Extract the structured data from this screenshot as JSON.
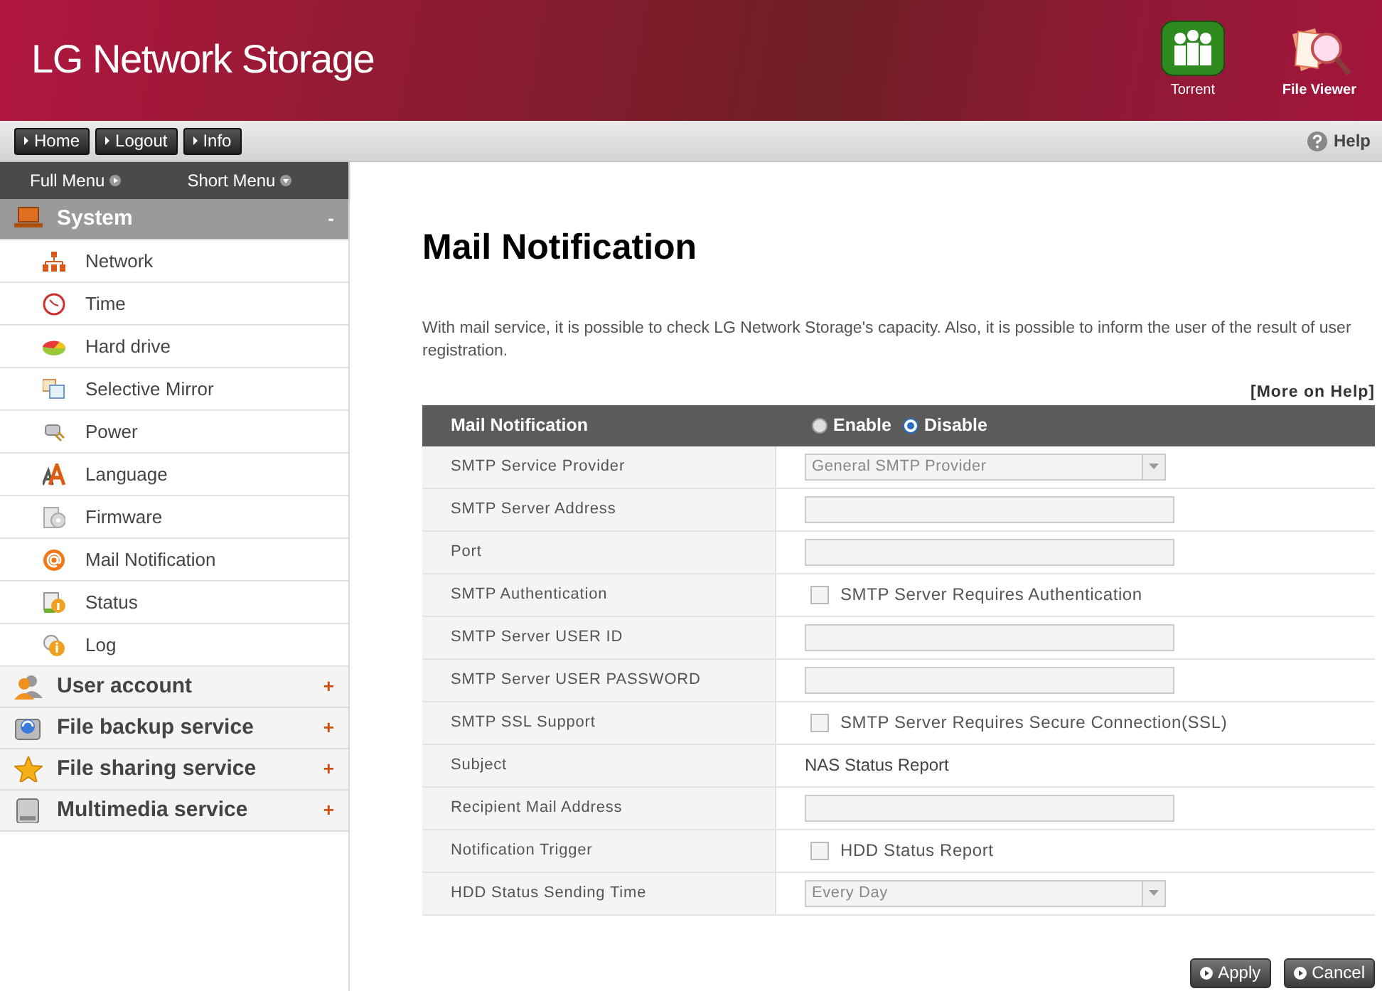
{
  "header": {
    "title": "LG Network Storage",
    "apps": [
      {
        "label": "Torrent"
      },
      {
        "label": "File Viewer"
      }
    ]
  },
  "toolbar": {
    "buttons": [
      "Home",
      "Logout",
      "Info"
    ],
    "help": "Help"
  },
  "sidebar": {
    "menus": [
      "Full Menu",
      "Short Menu"
    ],
    "sections": [
      {
        "label": "System",
        "expanded": true,
        "toggle": "-",
        "items": [
          "Network",
          "Time",
          "Hard drive",
          "Selective Mirror",
          "Power",
          "Language",
          "Firmware",
          "Mail Notification",
          "Status",
          "Log"
        ]
      },
      {
        "label": "User account",
        "expanded": false,
        "toggle": "+"
      },
      {
        "label": "File backup service",
        "expanded": false,
        "toggle": "+"
      },
      {
        "label": "File sharing service",
        "expanded": false,
        "toggle": "+"
      },
      {
        "label": "Multimedia service",
        "expanded": false,
        "toggle": "+"
      }
    ]
  },
  "main": {
    "title": "Mail Notification",
    "description": "With mail service, it is possible to check LG Network Storage's capacity. Also, it is possible to inform the user of the result of user registration.",
    "help_link": "[More on Help]",
    "form": {
      "header": "Mail Notification",
      "options": [
        {
          "label": "Enable",
          "selected": false
        },
        {
          "label": "Disable",
          "selected": true
        }
      ],
      "rows": [
        {
          "label": "SMTP Service Provider",
          "kind": "select",
          "value": "General SMTP Provider"
        },
        {
          "label": "SMTP Server Address",
          "kind": "text"
        },
        {
          "label": "Port",
          "kind": "text"
        },
        {
          "label": "SMTP Authentication",
          "kind": "checkbox",
          "checked": false,
          "text": "SMTP Server Requires Authentication"
        },
        {
          "label": "SMTP Server USER ID",
          "kind": "text"
        },
        {
          "label": "SMTP Server USER PASSWORD",
          "kind": "text"
        },
        {
          "label": "SMTP SSL Support",
          "kind": "checkbox",
          "checked": false,
          "text": "SMTP Server Requires Secure Connection(SSL)"
        },
        {
          "label": "Subject",
          "kind": "static",
          "value": "NAS Status Report"
        },
        {
          "label": "Recipient Mail Address",
          "kind": "text"
        },
        {
          "label": "Notification Trigger",
          "kind": "checkbox",
          "checked": false,
          "text": "HDD Status Report"
        },
        {
          "label": "HDD Status Sending Time",
          "kind": "select",
          "value": "Every Day"
        }
      ]
    },
    "buttons": [
      "Apply",
      "Cancel"
    ]
  }
}
